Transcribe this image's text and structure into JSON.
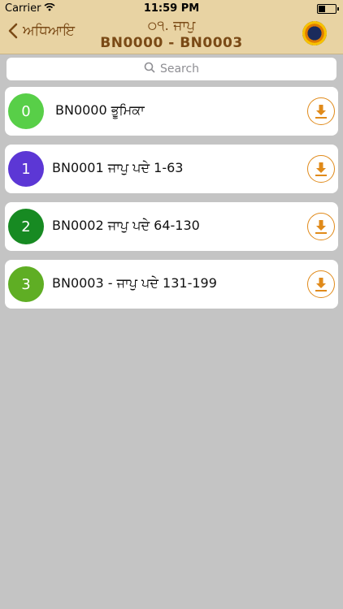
{
  "status": {
    "carrier": "Carrier",
    "time": "11:59 PM"
  },
  "nav": {
    "back_label": "ਅਧਿਆਇ",
    "title_line1": "੦੧. ਜਾਪੁ",
    "title_line2": "BN0000 - BN0003"
  },
  "search": {
    "placeholder": "Search"
  },
  "items": [
    {
      "num": "0",
      "title": "BN0000 ਭੂਮਿਕਾ",
      "color": "#58cf48"
    },
    {
      "num": "1",
      "title": "BN0001 ਜਾਪੁ ਪਦੇ 1-63",
      "color": "#5c37d5"
    },
    {
      "num": "2",
      "title": "BN0002 ਜਾਪੁ ਪਦੇ 64-130",
      "color": "#178a22"
    },
    {
      "num": "3",
      "title": "BN0003 - ਜਾਪੁ ਪਦੇ 131-199",
      "color": "#5fae24"
    }
  ],
  "colors": {
    "accent": "#7a4a16",
    "download": "#e08a1a",
    "navbar": "#e8d3a3"
  }
}
